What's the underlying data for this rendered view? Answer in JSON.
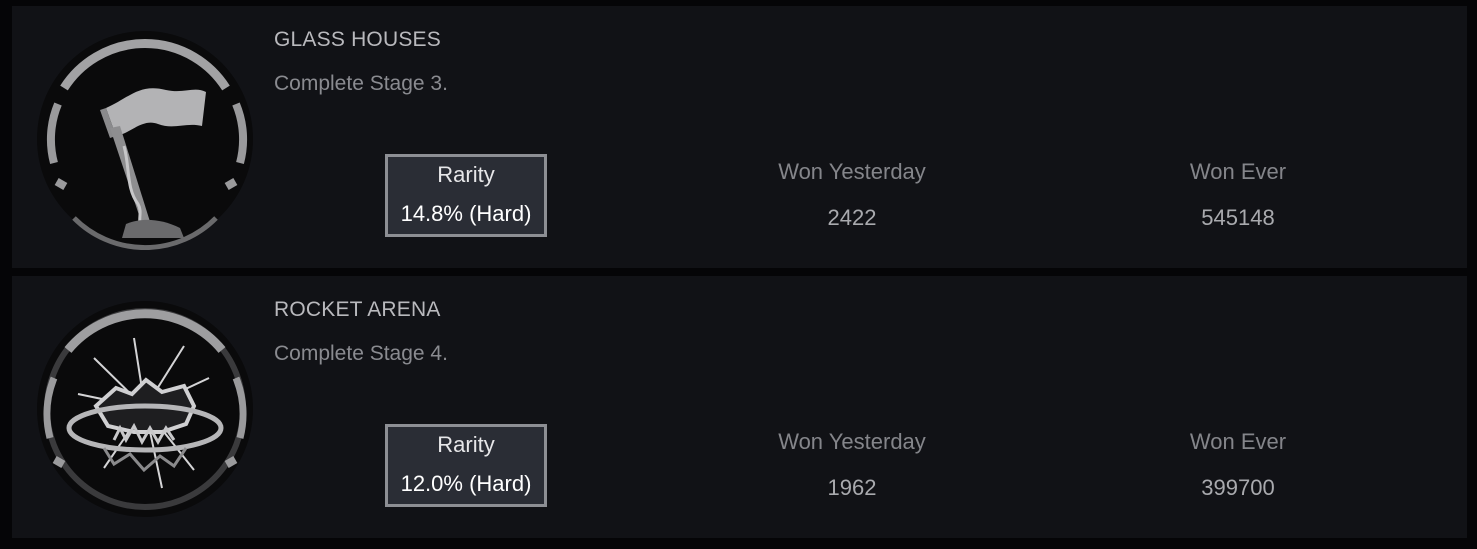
{
  "achievements": [
    {
      "icon": "flag-on-pole-icon",
      "title": "GLASS HOUSES",
      "description": "Complete Stage 3.",
      "rarity_label": "Rarity",
      "rarity_value": "14.8% (Hard)",
      "won_yesterday_label": "Won Yesterday",
      "won_yesterday": "2422",
      "won_ever_label": "Won Ever",
      "won_ever": "545148"
    },
    {
      "icon": "shattered-arena-icon",
      "title": "ROCKET ARENA",
      "description": "Complete Stage 4.",
      "rarity_label": "Rarity",
      "rarity_value": "12.0% (Hard)",
      "won_yesterday_label": "Won Yesterday",
      "won_yesterday": "1962",
      "won_ever_label": "Won Ever",
      "won_ever": "399700"
    }
  ],
  "colors": {
    "page_background": "#050507",
    "card_background": "#111216",
    "rarity_box_background": "#2a2d35",
    "rarity_box_border": "#8d8f94",
    "title_text": "#b9b9bd",
    "muted_text": "#84858a"
  }
}
